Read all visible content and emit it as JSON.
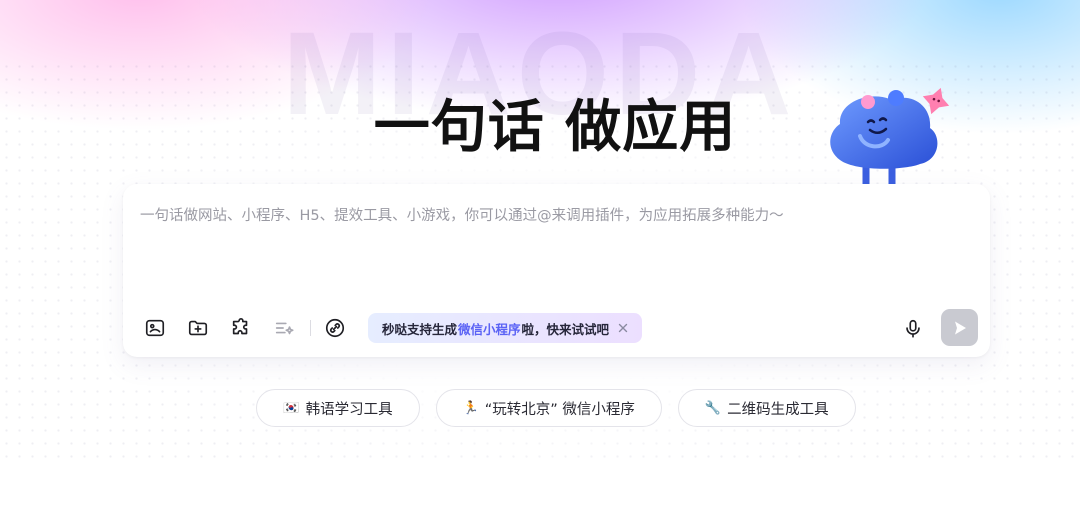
{
  "brand": {
    "watermark": "MIAODA"
  },
  "hero": {
    "title": "一句话 做应用"
  },
  "prompt": {
    "placeholder": "一句话做网站、小程序、H5、提效工具、小游戏，你可以通过@来调用插件，为应用拓展多种能力～",
    "value": ""
  },
  "toolbar": {
    "icons": [
      "image-upload-icon",
      "folder-add-icon",
      "plugin-icon",
      "prompt-enhance-icon",
      "link-icon"
    ],
    "promo": {
      "prefix": "秒哒支持生成",
      "highlight": "微信小程序",
      "suffix": "啦，快来试试吧"
    },
    "mic_icon": "microphone-icon",
    "send_icon": "send-icon"
  },
  "suggestions": [
    {
      "emoji": "🇰🇷",
      "label": "韩语学习工具"
    },
    {
      "emoji": "🏃",
      "label": "“玩转北京” 微信小程序"
    },
    {
      "emoji": "🔧",
      "label": "二维码生成工具"
    }
  ],
  "colors": {
    "accent": "#5a62f5",
    "send_disabled": "#c9cad1",
    "mascot": "#3d6ff0"
  }
}
